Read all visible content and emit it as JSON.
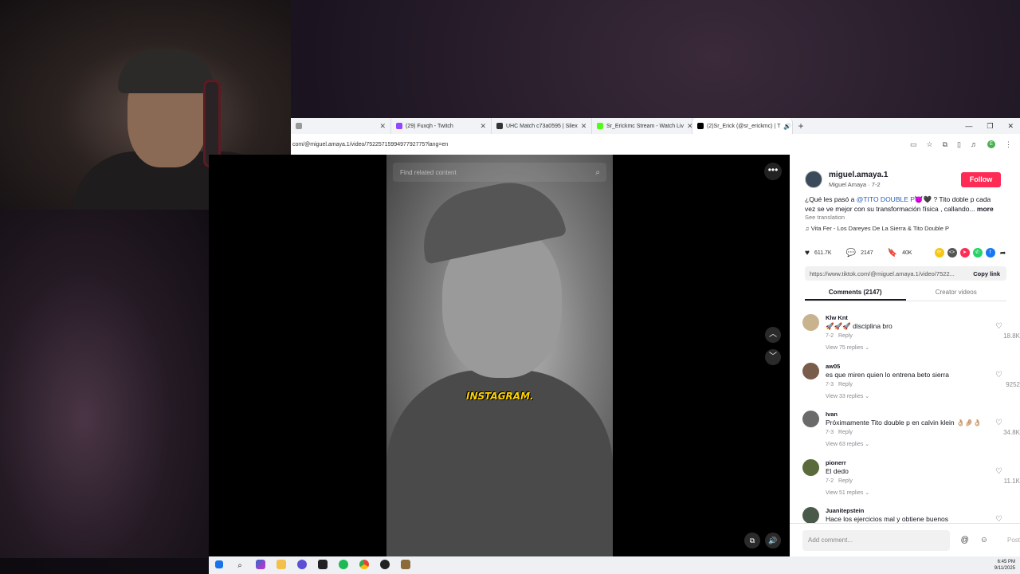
{
  "browser": {
    "tabs": [
      {
        "label": "",
        "color": "#999999",
        "active": false
      },
      {
        "label": "(29) Fuxqh - Twitch",
        "color": "#9146ff",
        "active": false
      },
      {
        "label": "UHC Match c73a0595 | Silex",
        "color": "#333333",
        "active": false
      },
      {
        "label": "Sr_Erickmc Stream - Watch Liv",
        "color": "#53fc18",
        "active": false
      },
      {
        "label": "(2)Sr_Erick (@sr_erickmc) | T",
        "color": "#000000",
        "active": true
      }
    ],
    "new_tab": "+",
    "url": "com/@miguel.amaya.1/video/7522571599497792775?lang=en",
    "profile_letter": "E"
  },
  "player": {
    "search_placeholder": "Find related content",
    "caption": "INSTAGRAM."
  },
  "post": {
    "username": "miguel.amaya.1",
    "display_name": "Miguel Amaya · 7-2",
    "follow_label": "Follow",
    "desc_before": "¿Qué les pasó a ",
    "desc_mention": "@TITO DOUBLE P",
    "desc_after": "😈🖤 ? Tito doble p cada vez se ve mejor con su transformación física , callando...",
    "desc_more": "more",
    "see_translation": "See translation",
    "music": "♫  Vita Fer - Los Dareyes De La Sierra & Tito Double P",
    "likes": "611.7K",
    "comments_count": "2147",
    "saves": "40K",
    "link": "https://www.tiktok.com/@miguel.amaya.1/video/7522...",
    "copy_link": "Copy link",
    "tab_comments": "Comments (2147)",
    "tab_creator": "Creator videos"
  },
  "comments": [
    {
      "user": "Klw Knt",
      "text": "🚀🚀🚀 disciplina bro",
      "date": "7-2",
      "reply": "Reply",
      "replies": "View 75 replies ⌄",
      "likes": "18.8K",
      "avatar": "#c9b38e"
    },
    {
      "user": "aw05",
      "text": "es que miren quien lo entrena beto sierra",
      "date": "7-3",
      "reply": "Reply",
      "replies": "View 33 replies ⌄",
      "likes": "9252",
      "avatar": "#7a5c4a"
    },
    {
      "user": "Ivan",
      "text": "Próximamente Tito double p en calvin klein 👌🏼🤌🏼👌🏼",
      "date": "7-3",
      "reply": "Reply",
      "replies": "View 63 replies ⌄",
      "likes": "34.8K",
      "avatar": "#6a6a6a"
    },
    {
      "user": "pionerr",
      "text": "El dedo",
      "date": "7-2",
      "reply": "Reply",
      "replies": "View 51 replies ⌄",
      "likes": "11.1K",
      "avatar": "#5a6a3a"
    },
    {
      "user": "Juanitepstein",
      "text": "Hace los ejercicios mal y obtiene buenos",
      "date": "",
      "reply": "",
      "replies": "",
      "likes": "",
      "avatar": "#4a5a4a"
    }
  ],
  "add_comment": {
    "placeholder": "Add comment...",
    "post": "Post"
  },
  "taskbar": {
    "time": "6:45 PM",
    "date": "9/11/2025"
  },
  "colors": {
    "follow": "#fe2c55",
    "caption": "#ffd400",
    "mention": "#2b5db9"
  }
}
